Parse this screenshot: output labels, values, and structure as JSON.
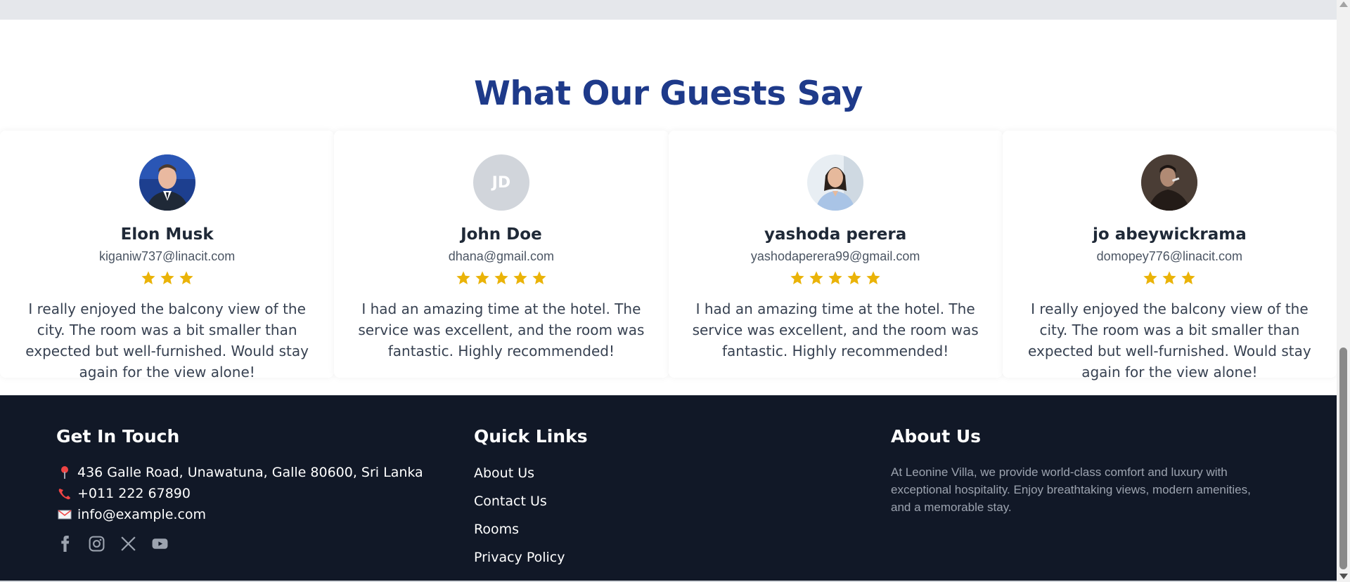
{
  "section": {
    "title": "What Our Guests Say"
  },
  "reviews": [
    {
      "name": "Elon Musk",
      "email": "kiganiw737@linacit.com",
      "rating": 3,
      "text": "I really enjoyed the balcony view of the city. The room was a bit smaller than expected but well-furnished. Would stay again for the view alone!",
      "avatar": "photo-man-suit"
    },
    {
      "name": "John Doe",
      "email": "dhana@gmail.com",
      "rating": 5,
      "text": "I had an amazing time at the hotel. The service was excellent, and the room was fantastic. Highly recommended!",
      "avatar": "initials",
      "initials": "JD"
    },
    {
      "name": "yashoda perera",
      "email": "yashodaperera99@gmail.com",
      "rating": 5,
      "text": "I had an amazing time at the hotel. The service was excellent, and the room was fantastic. Highly recommended!",
      "avatar": "photo-woman"
    },
    {
      "name": "jo abeywickrama",
      "email": "domopey776@linacit.com",
      "rating": 3,
      "text": "I really enjoyed the balcony view of the city. The room was a bit smaller than expected but well-furnished. Would stay again for the view alone!",
      "avatar": "photo-man-dark"
    }
  ],
  "footer": {
    "contact": {
      "heading": "Get In Touch",
      "address": "436 Galle Road, Unawatuna, Galle 80600, Sri Lanka",
      "phone": "+011 222 67890",
      "email": "info@example.com",
      "social_icons": [
        "facebook-icon",
        "instagram-icon",
        "x-icon",
        "youtube-icon"
      ]
    },
    "quick_links": {
      "heading": "Quick Links",
      "items": [
        "About Us",
        "Contact Us",
        "Rooms",
        "Privacy Policy"
      ]
    },
    "about": {
      "heading": "About Us",
      "text": "At Leonine Villa, we provide world-class comfort and luxury with exceptional hospitality. Enjoy breathtaking views, modern amenities, and a memorable stay."
    }
  },
  "colors": {
    "title": "#1e3a8a",
    "star": "#eab308",
    "footer_bg": "#111827",
    "muted": "#9ca3af"
  }
}
